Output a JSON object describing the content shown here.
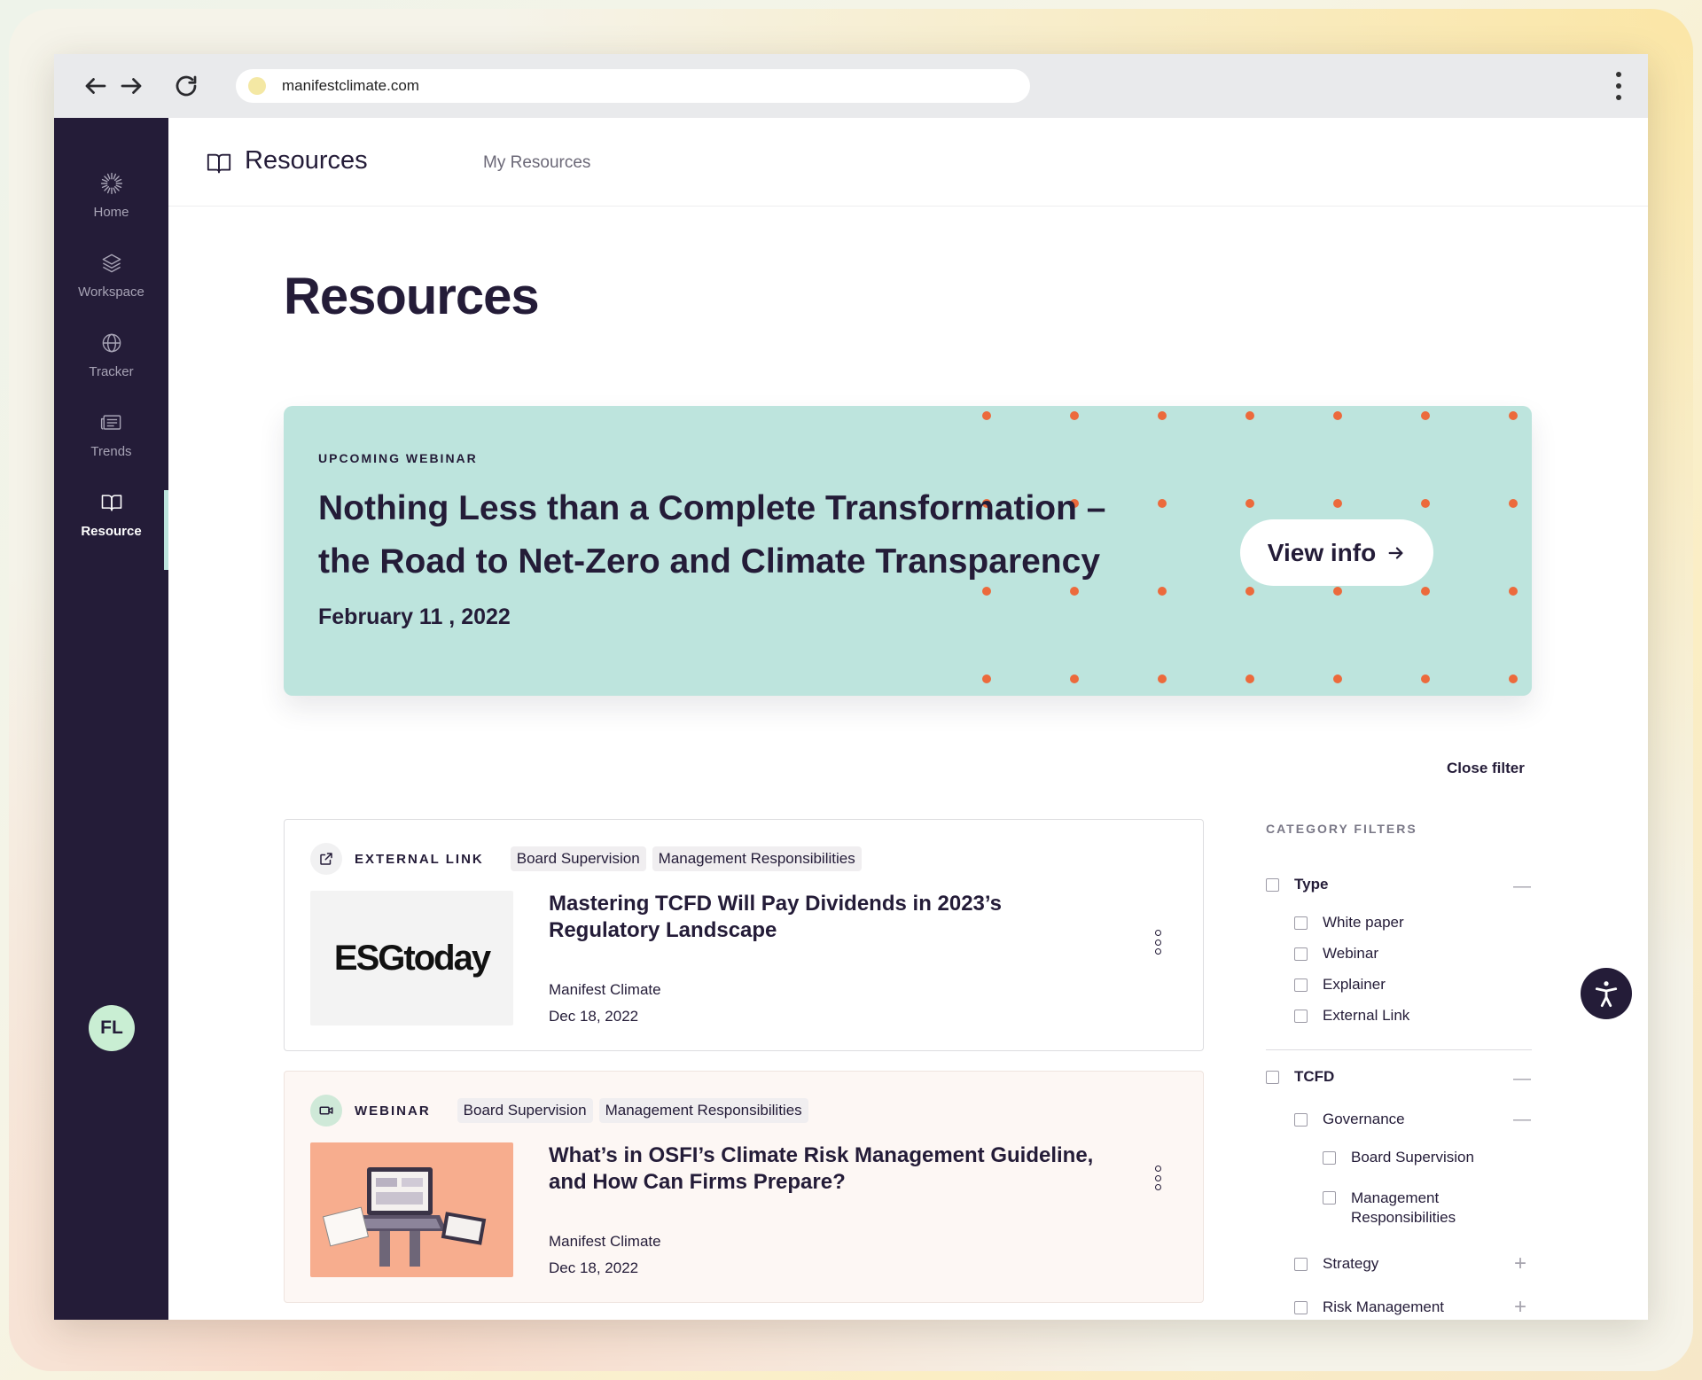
{
  "browser": {
    "url": "manifestclimate.com",
    "icons": [
      "back-arrow-icon",
      "forward-arrow-icon",
      "reload-icon",
      "site-dot-icon",
      "kebab-icon"
    ]
  },
  "sidebar": {
    "items": [
      {
        "label": "Home",
        "icon": "sunburst-icon"
      },
      {
        "label": "Workspace",
        "icon": "layers-icon"
      },
      {
        "label": "Tracker",
        "icon": "globe-icon"
      },
      {
        "label": "Trends",
        "icon": "newspaper-icon"
      },
      {
        "label": "Resource",
        "icon": "book-icon",
        "active": true
      }
    ],
    "avatar": "FL"
  },
  "topbar": {
    "title": "Resources",
    "tab": "My Resources"
  },
  "page": {
    "title": "Resources"
  },
  "banner": {
    "eyebrow": "UPCOMING WEBINAR",
    "title": "Nothing Less than a Complete Transformation – the Road to Net-Zero and Climate Transparency",
    "date": "February 11 , 2022",
    "button": "View info",
    "colors": {
      "bg": "#bde4dd",
      "dot": "#ec6a3c"
    }
  },
  "close_filter": "Close filter",
  "cards": [
    {
      "type": "EXTERNAL LINK",
      "tags": [
        "Board Supervision",
        "Management Responsibilities"
      ],
      "thumb_text": "ESGtoday",
      "title": "Mastering TCFD Will Pay Dividends in 2023’s Regulatory Landscape",
      "author": "Manifest Climate",
      "date": "Dec 18, 2022"
    },
    {
      "type": "WEBINAR",
      "tags": [
        "Board Supervision",
        "Management Responsibilities"
      ],
      "title": "What’s in OSFI’s Climate Risk Management Guideline, and How Can Firms Prepare?",
      "author": "Manifest Climate",
      "date": "Dec 18, 2022"
    }
  ],
  "filters": {
    "title": "CATEGORY FILTERS",
    "type_group": {
      "label": "Type",
      "options": [
        "White paper",
        "Webinar",
        "Explainer",
        "External Link"
      ]
    },
    "tcfd_group": {
      "label": "TCFD",
      "governance": {
        "label": "Governance",
        "options": [
          "Board Supervision",
          "Management Responsibilities"
        ]
      },
      "strategy": "Strategy",
      "risk": "Risk Management"
    },
    "collapse_symbol": "—",
    "expand_symbol": "+"
  }
}
